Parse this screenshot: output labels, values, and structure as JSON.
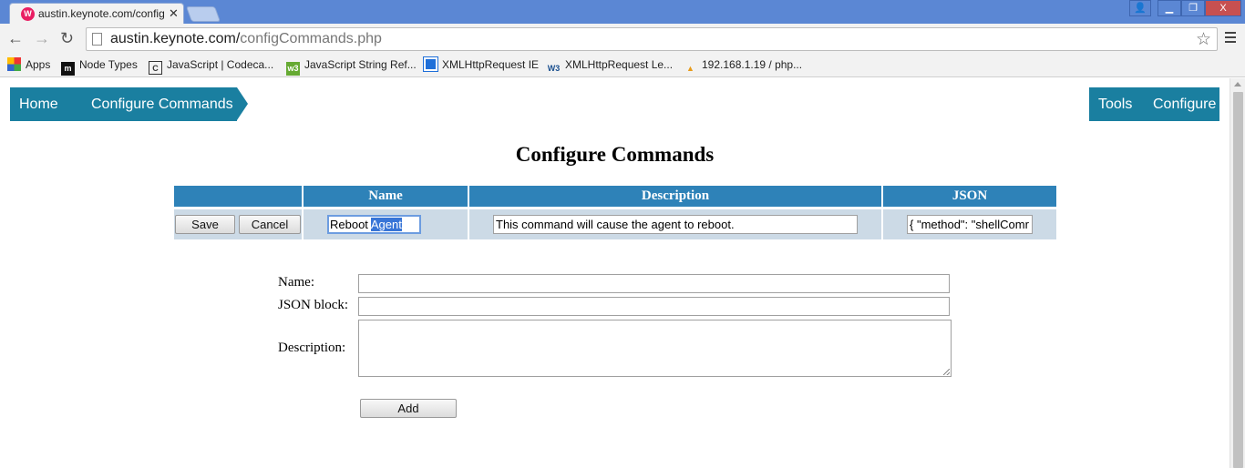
{
  "browser": {
    "tab_title": "austin.keynote.com/config",
    "url_host": "austin.keynote.com/",
    "url_path": "configCommands.php",
    "bookmarks": [
      {
        "label": "Apps",
        "icon": "apps-grid-icon"
      },
      {
        "label": "Node Types",
        "icon": "m-logo-icon"
      },
      {
        "label": "JavaScript | Codeca...",
        "icon": "codecademy-icon"
      },
      {
        "label": "JavaScript String Ref...",
        "icon": "w3schools-icon"
      },
      {
        "label": "XMLHttpRequest IE",
        "icon": "windows-logo-icon"
      },
      {
        "label": "XMLHttpRequest Le...",
        "icon": "w3c-icon"
      },
      {
        "label": "192.168.1.19 / php...",
        "icon": "phpmyadmin-icon"
      }
    ]
  },
  "nav": {
    "home": "Home",
    "configure_commands": "Configure Commands",
    "tools": "Tools",
    "configure": "Configure"
  },
  "page": {
    "title": "Configure Commands"
  },
  "commands_table": {
    "headers": [
      "",
      "Name",
      "Description",
      "JSON"
    ],
    "row": {
      "save_label": "Save",
      "cancel_label": "Cancel",
      "name_before_selection": "Reboot ",
      "name_selected": "Agent",
      "description": "This command will cause the agent to reboot.",
      "json": "{ \"method\": \"shellComr"
    }
  },
  "new_command_form": {
    "name_label": "Name:",
    "json_label": "JSON block:",
    "description_label": "Description:",
    "name_value": "",
    "json_value": "",
    "description_value": "",
    "add_label": "Add"
  },
  "colors": {
    "nav_background": "#1a7fa0",
    "table_header": "#2e82b8",
    "table_cell": "#ccdae6",
    "browser_frame": "#5b87d4"
  }
}
